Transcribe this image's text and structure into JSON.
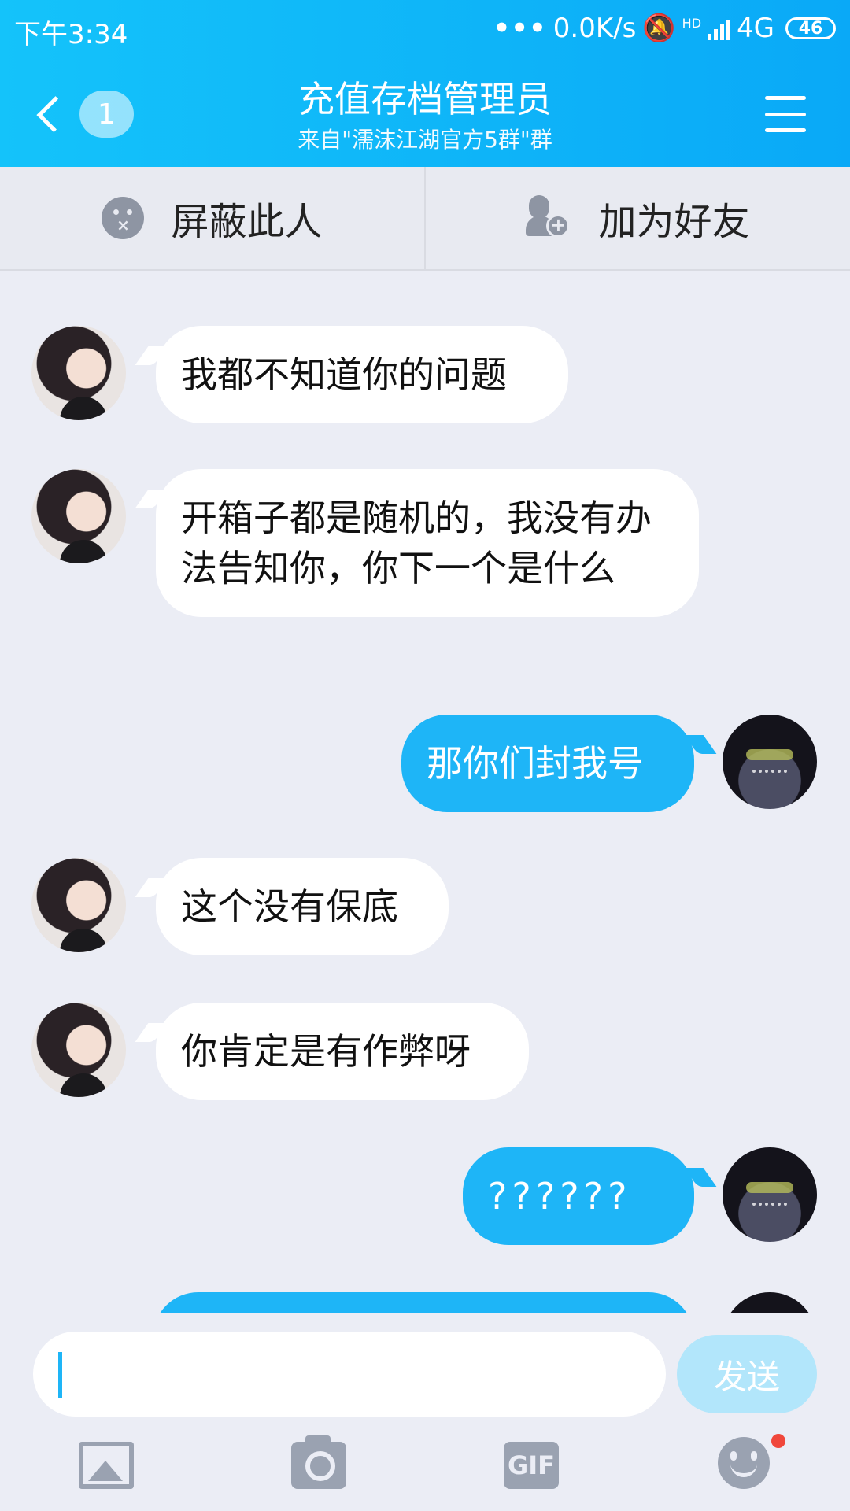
{
  "status_bar": {
    "time": "下午3:34",
    "dots": "•••",
    "speed": "0.0K/s",
    "network": "4G",
    "hd": "HD",
    "battery": "46"
  },
  "header": {
    "unread_count": "1",
    "title": "充值存档管理员",
    "subtitle": "来自\"濡沫江湖官方5群\"群"
  },
  "actions": {
    "block_label": "屏蔽此人",
    "add_friend_label": "加为好友"
  },
  "messages": [
    {
      "side": "in",
      "avatar": "girl-avatar",
      "text": "我都不知道你的问题"
    },
    {
      "side": "in",
      "avatar": "girl-avatar",
      "text": "开箱子都是随机的，我没有办法告知你，你下一个是什么"
    },
    {
      "side": "out",
      "avatar": "totoro-avatar",
      "text": "那你们封我号"
    },
    {
      "side": "in",
      "avatar": "girl-avatar",
      "text": "这个没有保底"
    },
    {
      "side": "in",
      "avatar": "girl-avatar",
      "text": "你肯定是有作弊呀"
    },
    {
      "side": "out",
      "avatar": "totoro-avatar",
      "text": "??????"
    }
  ],
  "input": {
    "value": "",
    "send_label": "发送"
  },
  "toolbar": {
    "gif_label": "GIF",
    "icons": [
      "image-icon",
      "camera-icon",
      "gif-icon",
      "emoji-icon"
    ]
  },
  "colors": {
    "header_start": "#14c3fa",
    "header_end": "#0aa9f7",
    "outgoing_bubble": "#1eb5f7",
    "incoming_bubble": "#ffffff",
    "chat_background": "#ebedf5",
    "send_button": "#b2e6fb",
    "notification_dot": "#f0473b"
  }
}
